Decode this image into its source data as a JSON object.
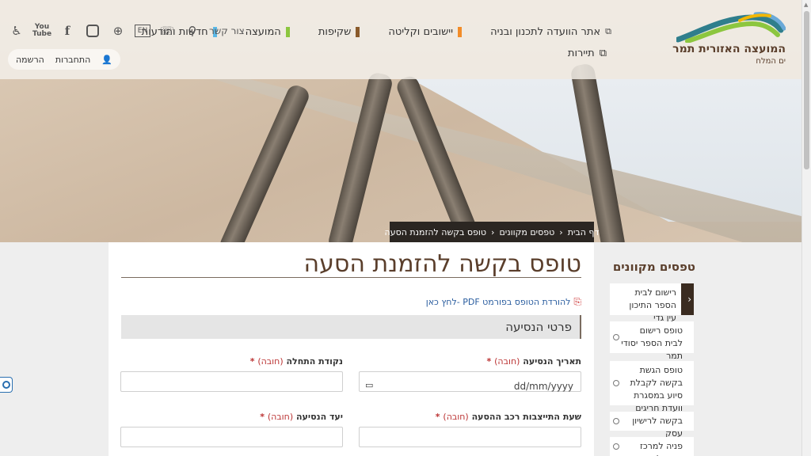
{
  "header": {
    "logo": {
      "name": "המועצה האזורית תמר",
      "sub": "ים המלח",
      "colors": [
        "#2f7e8c",
        "#8cc63f",
        "#f2b705",
        "#6aa9d8"
      ]
    },
    "nav": [
      {
        "label": "חדשות והודעות",
        "color": "#5bb8e6"
      },
      {
        "label": "המועצה",
        "color": "#8cc63f"
      },
      {
        "label": "שקיפות",
        "color": "#8a5a2b"
      },
      {
        "label": "יישובים וקליטה",
        "color": "#f28c28"
      },
      {
        "label": "אתר הוועדה לתכנון ובניה",
        "color": ""
      }
    ],
    "nav_row2": "תיירות",
    "utility_icons": [
      "accessibility-icon",
      "youtube-icon",
      "facebook-icon",
      "instagram-icon",
      "globe-icon",
      "search-icon"
    ],
    "utility_texts": {
      "youtube": "You Tube",
      "lang": "EN",
      "contact": "צור קשר"
    },
    "login": {
      "register": "הרשמה",
      "login": "התחברות"
    }
  },
  "breadcrumb": {
    "home": "דף הבית",
    "forms": "טפסים מקוונים",
    "current": "טופס בקשה להזמנת הסעה"
  },
  "main": {
    "title": "טופס בקשה להזמנת הסעה",
    "pdf_link": "להורדת הטופס בפורמט PDF -לחץ כאן",
    "section": "פרטי הנסיעה",
    "required_text": "(חובה)",
    "fields": {
      "trip_date": {
        "label": "תאריך הנסיעה",
        "placeholder": "dd/mm/yyyy"
      },
      "start_point": {
        "label": "נקודת התחלה",
        "value": ""
      },
      "vehicle_time": {
        "label": "שעת התייצבות רכב ההסעה",
        "value": ""
      },
      "destination": {
        "label": "יעד הנסיעה",
        "value": ""
      }
    }
  },
  "sidebar": {
    "title": "טפסים מקוונים",
    "items": [
      {
        "label": "רישום לבית הספר התיכון עין גדי"
      },
      {
        "label": "טופס רישום לבית הספר יסודי תמר"
      },
      {
        "label": "טופס הגשת בקשה לקבלת סיוע במסגרת וועדת חריגים"
      },
      {
        "label": "בקשה לרישיון עסק"
      },
      {
        "label": "פניה למרכז הטיפול"
      }
    ]
  }
}
